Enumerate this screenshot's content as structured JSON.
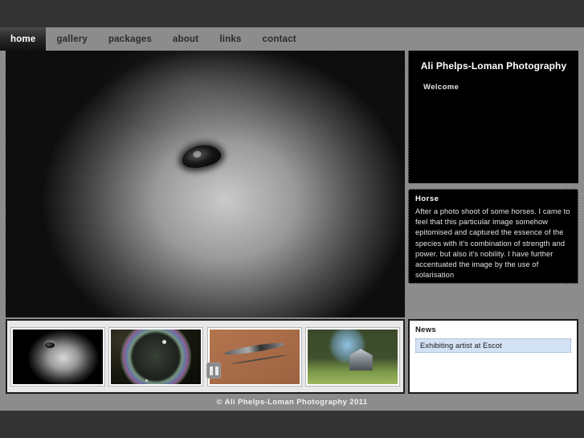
{
  "nav": {
    "items": [
      {
        "label": "home",
        "name": "nav-item-home",
        "active": true
      },
      {
        "label": "gallery",
        "name": "nav-item-gallery",
        "active": false
      },
      {
        "label": "packages",
        "name": "nav-item-packages",
        "active": false
      },
      {
        "label": "about",
        "name": "nav-item-about",
        "active": false
      },
      {
        "label": "links",
        "name": "nav-item-links",
        "active": false
      },
      {
        "label": "contact",
        "name": "nav-item-contact",
        "active": false
      }
    ]
  },
  "intro": {
    "site_title": "Ali Phelps-Loman Photography",
    "welcome": "Welcome"
  },
  "hero": {
    "alt": "Black and white close-up portrait of a horse's head",
    "slideshow_toggle": "pause"
  },
  "caption": {
    "title": "Horse",
    "body": "After a photo shoot of some horses. I came to feel that this particular image somehow epitomised and captured the essence of the species with it's combination of strength and power. but also it's nobility. I have further accentuated the image by the use of solarisation"
  },
  "thumbnails": [
    {
      "name": "thumbnail-horse",
      "alt": "Black and white horse head"
    },
    {
      "name": "thumbnail-bubble",
      "alt": "Iridescent soap bubble"
    },
    {
      "name": "thumbnail-bird",
      "alt": "Bird in flight on terracotta background"
    },
    {
      "name": "thumbnail-church",
      "alt": "Stone church among trees"
    }
  ],
  "news": {
    "title": "News",
    "items": [
      {
        "label": "Exhibiting artist at Escot"
      }
    ]
  },
  "footer": {
    "copyright": "© Ali Phelps-Loman Photography 2011"
  },
  "colors": {
    "chrome_gray": "#8c8c8c",
    "outer_dark": "#333333",
    "panel_black": "#000000",
    "news_highlight": "#d3e2f5",
    "active_tab_text": "#ffffff"
  }
}
